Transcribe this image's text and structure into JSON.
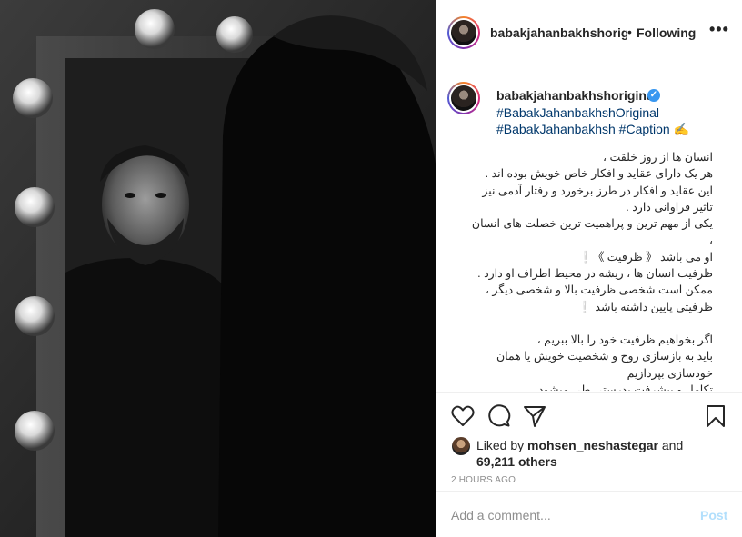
{
  "post": {
    "username": "babakjahanbakhshoriginal",
    "header_username_display": "babakjahanbakhshorigi",
    "header_dot": "•",
    "follow_status": "Following",
    "more_icon": "more-horizontal-icon",
    "caption_tag_line1": "#BabakJahanbakhshOriginal",
    "caption_tag_line2_a": "#BabakJahanbakhsh",
    "caption_tag_line2_b": "#Caption",
    "caption_emoji": "✍",
    "caption_lines": [
      "انسان ها از روز خلقت ،",
      "هر یک دارای عقاید و افکار خاص خویش بوده اند .",
      "این عقاید و افکار در طرز برخورد و رفتار آدمی نیز",
      "تاثیر فراوانی دارد .",
      "یکی از مهم ترین و پراهمیت ترین خصلت های انسان",
      "،",
      "او می باشد 《 ظرفیت 》❕",
      "ظرفیت انسان ها ، ریشه در محیط اطراف او دارد .",
      "ممکن است شخصی ظرفیت بالا و شخصی دیگر ،",
      "ظرفیتی پایین داشته باشد ❕",
      "",
      "اگر بخواهیم ظرفیت خود را بالا ببریم ،",
      "باید به بازسازی روح و شخصیت خویش یا همان",
      "خودسازی بپردازیم",
      "تکامل و پیشرفت بدرستی طی میشود"
    ],
    "liked_by_prefix": "Liked by",
    "liked_by_user": "mohsen_neshastegar",
    "liked_by_and": "and",
    "likes_others": "69,211 others",
    "timestamp": "2 HOURS AGO",
    "comment_placeholder": "Add a comment...",
    "post_button": "Post"
  },
  "colors": {
    "link": "#00376b",
    "verified": "#3897f0",
    "post_button": "#b2dffc",
    "muted": "#8e8e8e"
  },
  "icons": [
    "heart-icon",
    "comment-icon",
    "share-icon",
    "bookmark-icon",
    "verified-badge-icon",
    "more-horizontal-icon"
  ]
}
